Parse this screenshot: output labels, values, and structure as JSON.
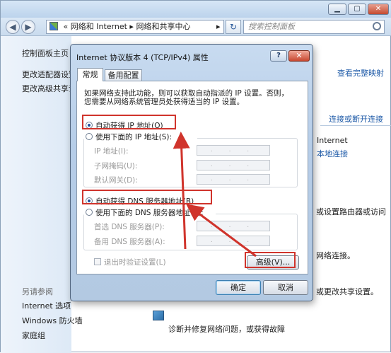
{
  "explorer": {
    "address": {
      "chevron": "«",
      "crumbs": [
        "网络和 Internet",
        "网络和共享中心"
      ],
      "sep": "▸"
    },
    "search_placeholder": "搜索控制面板",
    "sidebar": {
      "home": "控制面板主页",
      "change_adapter": "更改适配器设置",
      "change_sharing": "更改高级共享设置",
      "see_also": "另请参阅",
      "internet_options": "Internet 选项",
      "firewall": "Windows 防火墙",
      "homegroup": "家庭组"
    },
    "right_fragments": {
      "see_full_map": "查看完整映射",
      "connect_disconnect": "连接或断开连接",
      "internet": "Internet",
      "local_conn": "本地连接",
      "router_text": "或设置路由器或访问",
      "net_conn": "网络连接。",
      "change_share": "或更改共享设置。",
      "troubleshoot": "诊断并修复网络问题，或获得故障"
    }
  },
  "dialog": {
    "title": "Internet 协议版本 4 (TCP/IPv4) 属性",
    "help": "?",
    "close": "✕",
    "tabs": [
      "常规",
      "备用配置"
    ],
    "intro_line1": "如果网络支持此功能，则可以获取自动指派的 IP 设置。否则，",
    "intro_line2": "您需要从网络系统管理员处获得适当的 IP 设置。",
    "auto_ip": "自动获得 IP 地址(O)",
    "manual_ip": "使用下面的 IP 地址(S):",
    "ip_label": "IP 地址(I):",
    "mask_label": "子网掩码(U):",
    "gateway_label": "默认网关(D):",
    "auto_dns": "自动获得 DNS 服务器地址(B)",
    "manual_dns": "使用下面的 DNS 服务器地址(E):",
    "pref_dns_label": "首选 DNS 服务器(P):",
    "alt_dns_label": "备用 DNS 服务器(A):",
    "validate": "退出时验证设置(L)",
    "advanced": "高级(V)...",
    "ok": "确定",
    "cancel": "取消",
    "ip_placeholder": ". . ."
  },
  "selection": {
    "ip_mode": "auto",
    "dns_mode": "auto",
    "validate_checked": false
  },
  "colors": {
    "annotation_red": "#d0342c",
    "dialog_frame": "#b6cde8",
    "link_blue": "#1f5ba8"
  }
}
